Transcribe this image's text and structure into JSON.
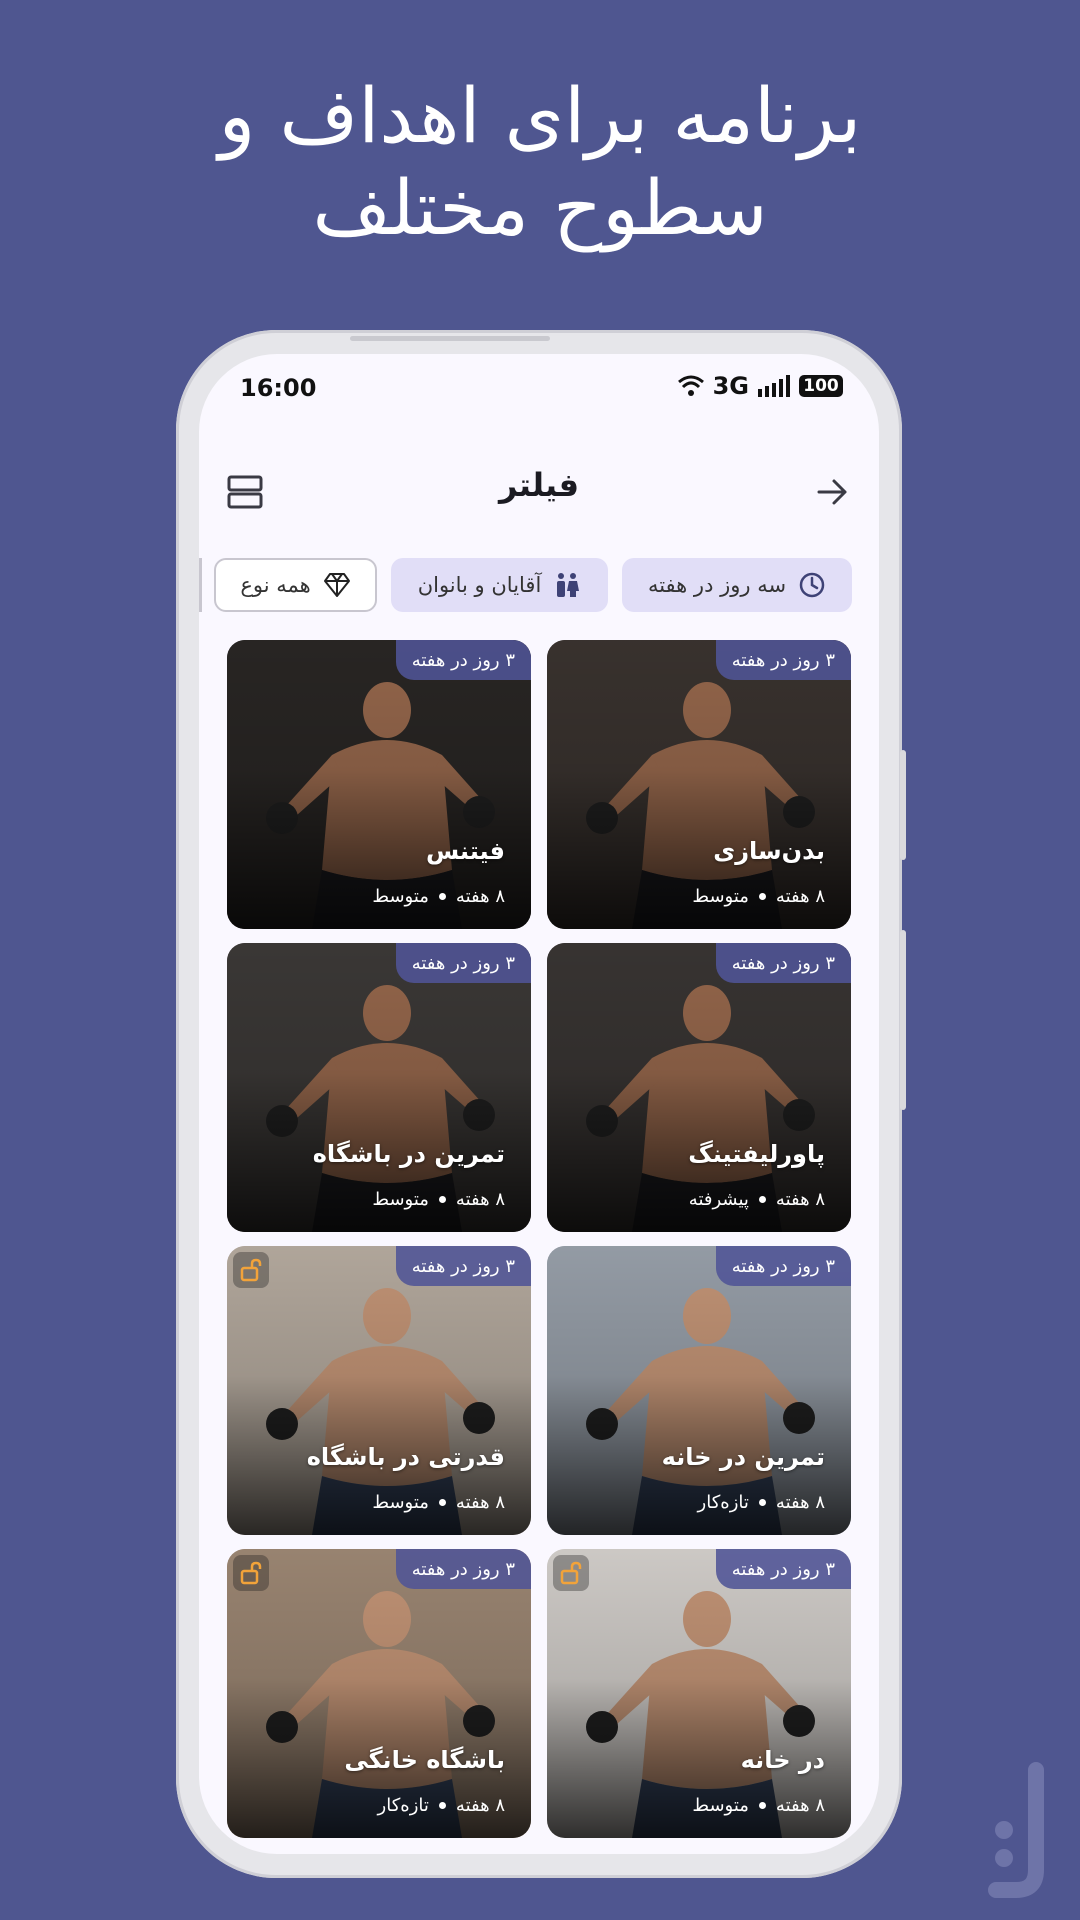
{
  "headline": {
    "line1": "برنامه برای اهداف و",
    "line2": "سطوح مختلف"
  },
  "status_bar": {
    "time": "16:00",
    "network": "3G",
    "battery": "100"
  },
  "app_bar": {
    "title": "فیلتر",
    "left_icon": "grid-layout-icon",
    "right_icon": "arrow-forward-icon"
  },
  "filters": [
    {
      "label": "سه روز در هفته",
      "icon": "clock-icon",
      "style": "filled"
    },
    {
      "label": "آقایان و بانوان",
      "icon": "people-icon",
      "style": "filled"
    },
    {
      "label": "همه نوع",
      "icon": "diamond-icon",
      "style": "outline"
    }
  ],
  "programs": [
    {
      "title": "بدن‌سازی",
      "badge": "۳ روز در هفته",
      "weeks": "۸ هفته",
      "level": "متوسط",
      "locked": false,
      "tone": "#3b3430"
    },
    {
      "title": "فیتنس",
      "badge": "۳ روز در هفته",
      "weeks": "۸ هفته",
      "level": "متوسط",
      "locked": false,
      "tone": "#2a2725"
    },
    {
      "title": "پاورلیفتینگ",
      "badge": "۳ روز در هفته",
      "weeks": "۸ هفته",
      "level": "پیشرفته",
      "locked": false,
      "tone": "#3a3634"
    },
    {
      "title": "تمرین در باشگاه",
      "badge": "۳ روز در هفته",
      "weeks": "۸ هفته",
      "level": "متوسط",
      "locked": false,
      "tone": "#3d3a38"
    },
    {
      "title": "تمرین در خانه",
      "badge": "۳ روز در هفته",
      "weeks": "۸ هفته",
      "level": "تازه‌کار",
      "locked": false,
      "tone": "#9ba3ad"
    },
    {
      "title": "قدرتی در باشگاه",
      "badge": "۳ روز در هفته",
      "weeks": "۸ هفته",
      "level": "متوسط",
      "locked": true,
      "tone": "#b9aea2"
    },
    {
      "title": "در خانه",
      "badge": "۳ روز در هفته",
      "weeks": "۸ هفته",
      "level": "متوسط",
      "locked": true,
      "tone": "#d7d3cf"
    },
    {
      "title": "باشگاه خانگی",
      "badge": "۳ روز در هفته",
      "weeks": "۸ هفته",
      "level": "تازه‌کار",
      "locked": true,
      "tone": "#a08a76"
    }
  ],
  "colors": {
    "background": "#4f5690",
    "chip_filled": "#e1def7",
    "badge": "#50549a",
    "lock_icon": "#f2a33a"
  }
}
